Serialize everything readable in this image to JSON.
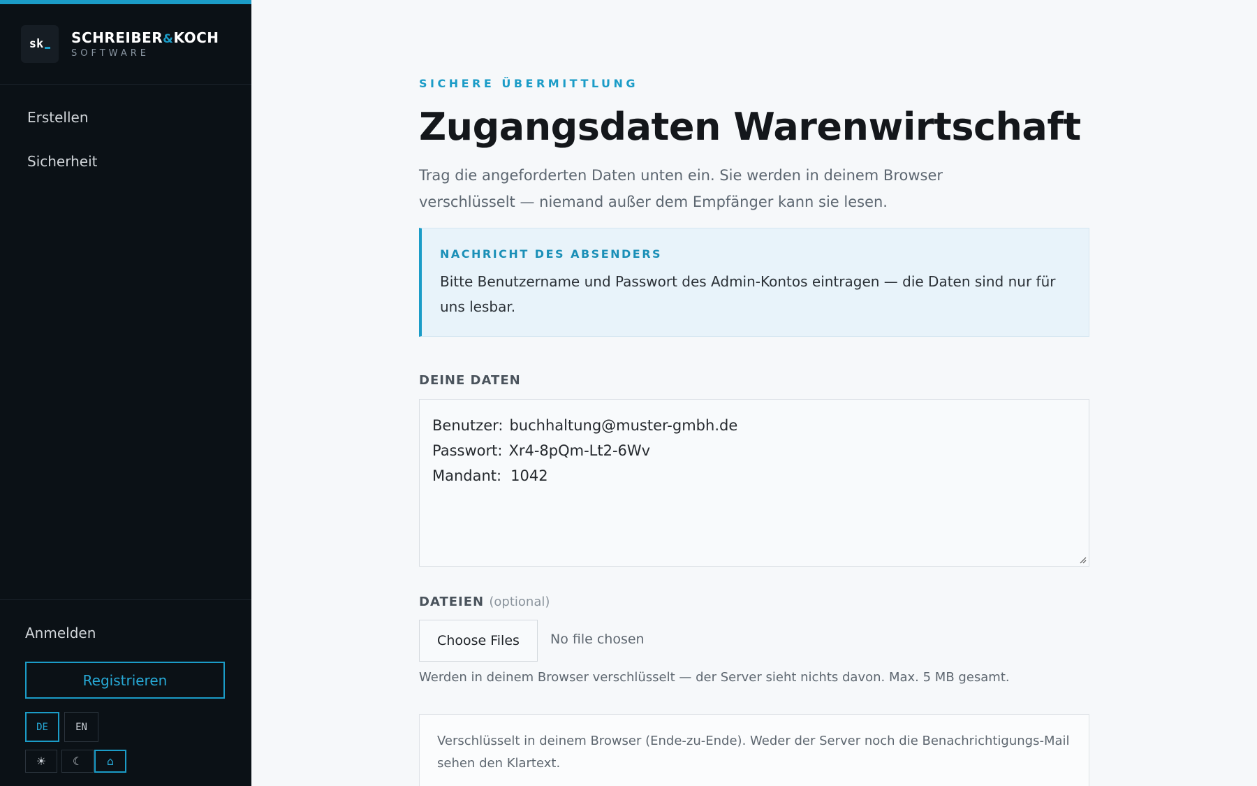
{
  "brand": {
    "mark": "sk",
    "name_part1": "SCHREIBER",
    "name_amp": "&",
    "name_part2": "KOCH",
    "sub": "SOFTWARE"
  },
  "sidebar": {
    "nav": [
      {
        "label": "Erstellen"
      },
      {
        "label": "Sicherheit"
      }
    ],
    "login_label": "Anmelden",
    "register_label": "Registrieren",
    "languages": [
      {
        "label": "DE",
        "active": true
      },
      {
        "label": "EN",
        "active": false
      }
    ],
    "themes": [
      {
        "glyph": "☀",
        "icon": "sun-icon"
      },
      {
        "glyph": "☾",
        "icon": "moon-icon"
      },
      {
        "glyph": "⌂",
        "icon": "system-theme-icon"
      }
    ]
  },
  "main": {
    "eyebrow": "SICHERE ÜBERMITTLUNG",
    "title": "Zugangsdaten Warenwirtschaft",
    "lead": "Trag die angeforderten Daten unten ein. Sie werden in deinem Browser verschlüsselt — niemand außer dem Empfänger kann sie lesen.",
    "notice": {
      "label": "NACHRICHT DES ABSENDERS",
      "text": "Bitte Benutzername und Passwort des Admin-Kontos eintragen — die Daten sind nur für uns lesbar."
    },
    "data_section": {
      "label": "DEINE DATEN",
      "lines": [
        {
          "key": "Benutzer:",
          "value": "buchhaltung@muster-gmbh.de"
        },
        {
          "key": "Passwort:",
          "value": "Xr4-8pQm-Lt2-6Wv"
        },
        {
          "key": "Mandant:",
          "value": "1042"
        }
      ]
    },
    "files_section": {
      "label": "DATEIEN",
      "optional": "(optional)",
      "button": "Choose Files",
      "status": "No file chosen",
      "hint": "Werden in deinem Browser verschlüsselt — der Server sieht nichts davon. Max. 5 MB gesamt."
    },
    "info": "Verschlüsselt in deinem Browser (Ende-zu-Ende). Weder der Server noch die Benachrichtigungs-Mail sehen den Klartext."
  },
  "colors": {
    "accent": "#1b9cc7",
    "sidebar_bg": "#0b1116",
    "page_bg": "#f6f8fa",
    "notice_bg": "#e8f3fa"
  }
}
